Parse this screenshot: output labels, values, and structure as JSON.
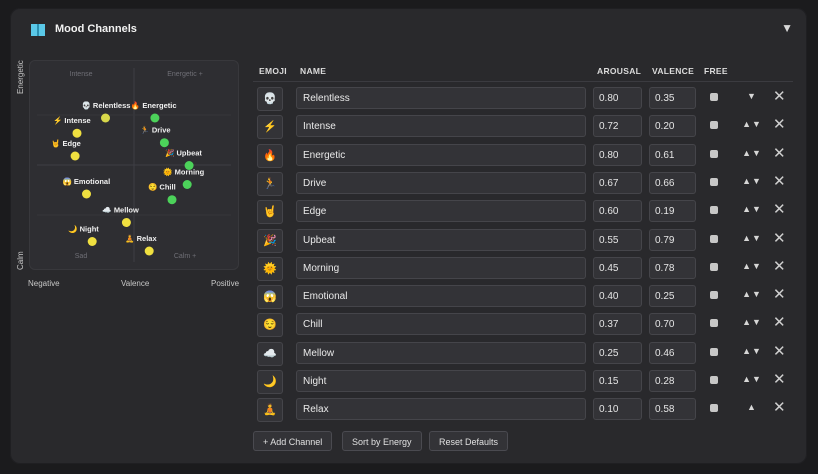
{
  "header": {
    "title": "Mood Channels",
    "icon": "book-icon",
    "caret_icon": "triangle-down-icon"
  },
  "plot": {
    "y_top": "Energetic",
    "y_bottom": "Calm",
    "x_left": "Negative",
    "x_mid": "Valence",
    "x_right": "Positive",
    "corner_tl": "Intense",
    "corner_tr": "Energetic +",
    "corner_bl": "Sad",
    "corner_br": "Calm +",
    "points": [
      {
        "label": "Relentless",
        "emoji": "💀",
        "arousal": 0.8,
        "valence": 0.35,
        "color": "#d8d84a"
      },
      {
        "label": "Intense",
        "emoji": "⚡",
        "arousal": 0.72,
        "valence": 0.2,
        "color": "#f0e040"
      },
      {
        "label": "Energetic",
        "emoji": "🔥",
        "arousal": 0.8,
        "valence": 0.61,
        "color": "#4cd25a"
      },
      {
        "label": "Drive",
        "emoji": "🏃",
        "arousal": 0.67,
        "valence": 0.66,
        "color": "#4cd25a"
      },
      {
        "label": "Edge",
        "emoji": "🤘",
        "arousal": 0.6,
        "valence": 0.19,
        "color": "#f0e040"
      },
      {
        "label": "Upbeat",
        "emoji": "🎉",
        "arousal": 0.55,
        "valence": 0.79,
        "color": "#4cd25a"
      },
      {
        "label": "Morning",
        "emoji": "🌞",
        "arousal": 0.45,
        "valence": 0.78,
        "color": "#4cd25a"
      },
      {
        "label": "Emotional",
        "emoji": "😱",
        "arousal": 0.4,
        "valence": 0.25,
        "color": "#f0e040"
      },
      {
        "label": "Chill",
        "emoji": "😌",
        "arousal": 0.37,
        "valence": 0.7,
        "color": "#4cd25a"
      },
      {
        "label": "Mellow",
        "emoji": "☁️",
        "arousal": 0.25,
        "valence": 0.46,
        "color": "#f0e040"
      },
      {
        "label": "Night",
        "emoji": "🌙",
        "arousal": 0.15,
        "valence": 0.28,
        "color": "#f0e040"
      },
      {
        "label": "Relax",
        "emoji": "🧘",
        "arousal": 0.1,
        "valence": 0.58,
        "color": "#f0e040"
      }
    ]
  },
  "table": {
    "headers": {
      "emoji": "EMOJI",
      "name": "NAME",
      "arousal": "AROUSAL",
      "valence": "VALENCE",
      "free": "FREE"
    },
    "rows": [
      {
        "emoji": "💀",
        "name": "Relentless",
        "arousal": "0.80",
        "valence": "0.35",
        "arrows": "▼"
      },
      {
        "emoji": "⚡",
        "name": "Intense",
        "arousal": "0.72",
        "valence": "0.20",
        "arrows": "▲▼"
      },
      {
        "emoji": "🔥",
        "name": "Energetic",
        "arousal": "0.80",
        "valence": "0.61",
        "arrows": "▲▼"
      },
      {
        "emoji": "🏃",
        "name": "Drive",
        "arousal": "0.67",
        "valence": "0.66",
        "arrows": "▲▼"
      },
      {
        "emoji": "🤘",
        "name": "Edge",
        "arousal": "0.60",
        "valence": "0.19",
        "arrows": "▲▼"
      },
      {
        "emoji": "🎉",
        "name": "Upbeat",
        "arousal": "0.55",
        "valence": "0.79",
        "arrows": "▲▼"
      },
      {
        "emoji": "🌞",
        "name": "Morning",
        "arousal": "0.45",
        "valence": "0.78",
        "arrows": "▲▼"
      },
      {
        "emoji": "😱",
        "name": "Emotional",
        "arousal": "0.40",
        "valence": "0.25",
        "arrows": "▲▼"
      },
      {
        "emoji": "😌",
        "name": "Chill",
        "arousal": "0.37",
        "valence": "0.70",
        "arrows": "▲▼"
      },
      {
        "emoji": "☁️",
        "name": "Mellow",
        "arousal": "0.25",
        "valence": "0.46",
        "arrows": "▲▼"
      },
      {
        "emoji": "🌙",
        "name": "Night",
        "arousal": "0.15",
        "valence": "0.28",
        "arrows": "▲▼"
      },
      {
        "emoji": "🧘",
        "name": "Relax",
        "arousal": "0.10",
        "valence": "0.58",
        "arrows": "▲"
      }
    ]
  },
  "buttons": {
    "add": "+ Add Channel",
    "sort": "Sort by Energy",
    "reset": "Reset Defaults"
  }
}
